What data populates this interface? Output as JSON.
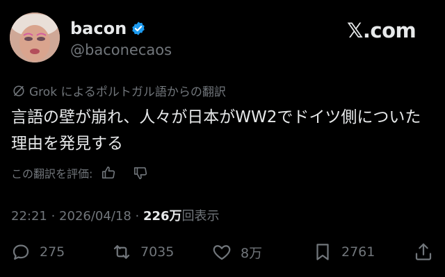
{
  "user": {
    "display_name": "bacon",
    "handle": "@baconecaos"
  },
  "brand": "𝕏.com",
  "translation_note": "Grok によるポルトガル語からの翻訳",
  "tweet_text": "言語の壁が崩れ、人々が日本がWW2でドイツ側についた理由を発見する",
  "rate_translation_label": "この翻訳を評価:",
  "meta": {
    "time": "22:21",
    "separator1": " · ",
    "date": "2026/04/18",
    "separator2": " · ",
    "views_count": "226万",
    "views_label": "回表示"
  },
  "actions": {
    "replies": "275",
    "reposts": "7035",
    "likes": "8万",
    "bookmarks": "2761"
  },
  "colors": {
    "background": "#000000",
    "text_primary": "#e7e9ea",
    "text_secondary": "#71767b",
    "verified": "#1d9bf0"
  },
  "icons": [
    "verified-badge-icon",
    "translate-icon",
    "thumbs-up-icon",
    "thumbs-down-icon",
    "reply-icon",
    "repost-icon",
    "like-icon",
    "bookmark-icon",
    "share-icon"
  ]
}
